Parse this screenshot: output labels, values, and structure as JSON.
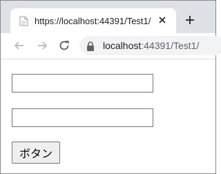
{
  "browser": {
    "tab": {
      "title": "https://localhost:44391/Test1/",
      "favicon_icon": "page-icon",
      "close_icon": "close-icon"
    },
    "new_tab_icon": "plus-icon",
    "toolbar": {
      "back_icon": "arrow-left-icon",
      "forward_icon": "arrow-right-icon",
      "reload_icon": "reload-icon",
      "lock_icon": "lock-icon",
      "url_host": "localhost",
      "url_path": ":44391/Test1/"
    }
  },
  "page": {
    "inputs": [
      {
        "value": "",
        "placeholder": ""
      },
      {
        "value": "",
        "placeholder": ""
      }
    ],
    "button_label": "ボタン"
  },
  "colors": {
    "tabstrip_bg": "#dee1e6",
    "omnibox_bg": "#f1f3f4",
    "button_bg": "#efefef"
  }
}
